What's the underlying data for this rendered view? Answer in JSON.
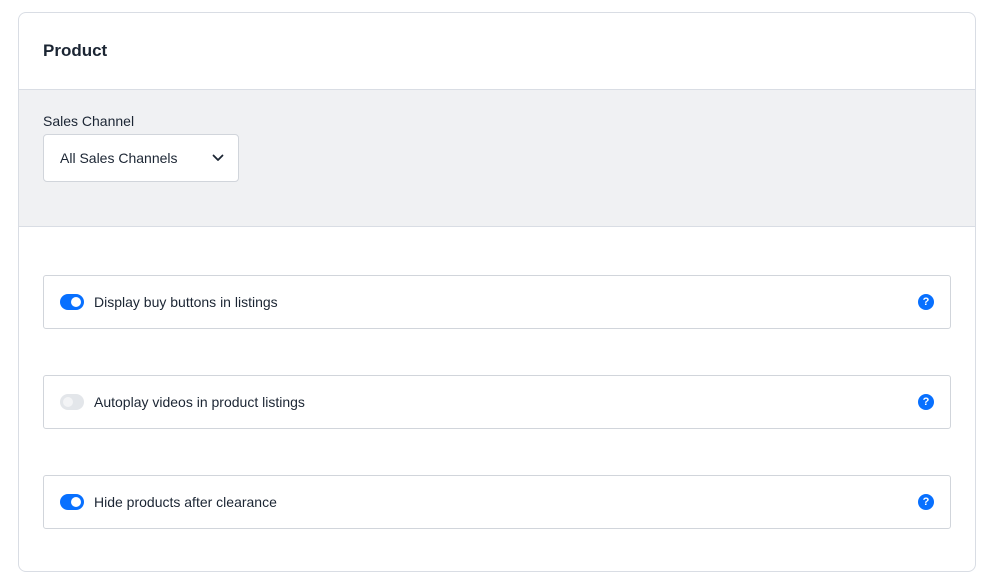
{
  "card": {
    "title": "Product"
  },
  "sales_channel": {
    "label": "Sales Channel",
    "selected": "All Sales Channels"
  },
  "settings": [
    {
      "label": "Display buy buttons in listings",
      "enabled": true,
      "help_icon": "?"
    },
    {
      "label": "Autoplay videos in product listings",
      "enabled": false,
      "help_icon": "?"
    },
    {
      "label": "Hide products after clearance",
      "enabled": true,
      "help_icon": "?"
    }
  ],
  "colors": {
    "accent": "#0870ff",
    "toolbar_bg": "#f0f1f3",
    "border": "#d9dde4",
    "text": "#1b2533"
  }
}
